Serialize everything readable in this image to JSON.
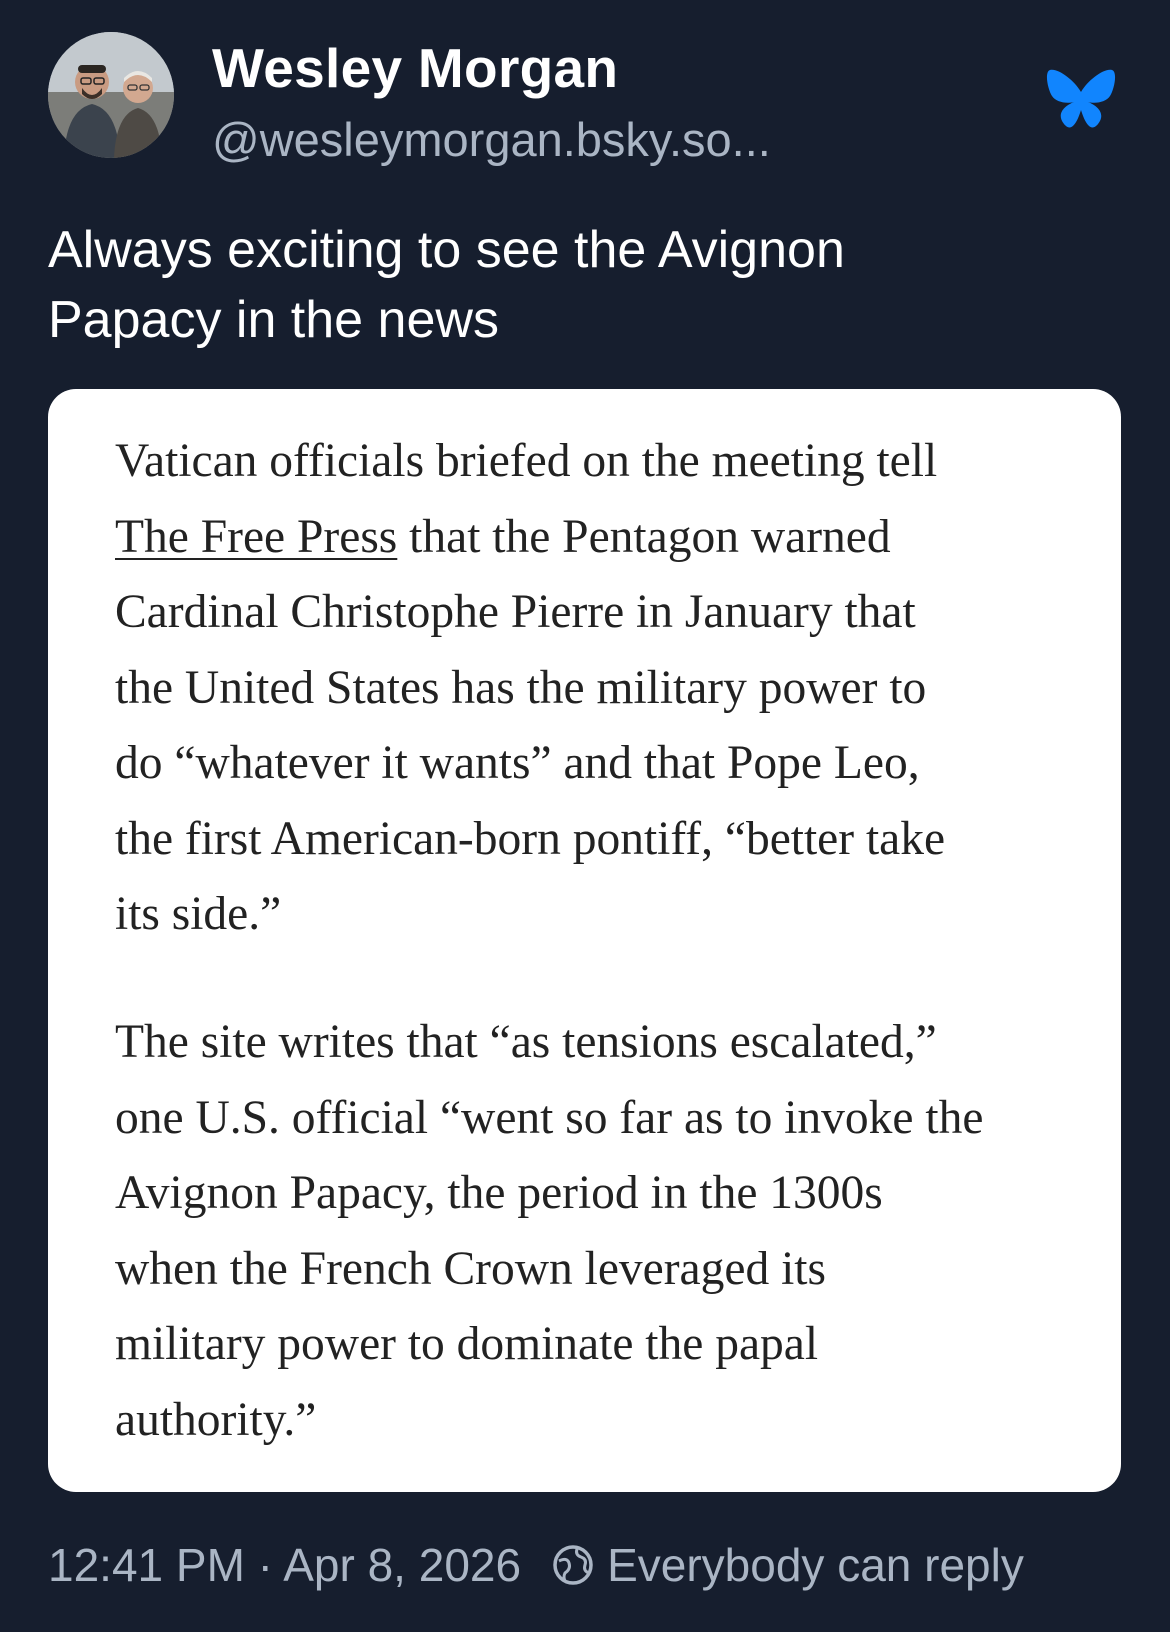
{
  "author": {
    "display_name": "Wesley Morgan",
    "handle": "@wesleymorgan.bsky.so..."
  },
  "app_icon": "bluesky-butterfly-icon",
  "post": {
    "text_line1": "Always exciting to see the Avignon",
    "text_line2": "Papacy in the news"
  },
  "quote": {
    "p1_line1": "Vatican officials briefed on the meeting tell",
    "p1_link": "The Free Press",
    "p1_line2_rest": " that the Pentagon warned",
    "p1_line3": "Cardinal Christophe Pierre in January that",
    "p1_line4": "the United States has the military power to",
    "p1_line5": "do “whatever it wants” and that Pope Leo,",
    "p1_line6": "the first American-born pontiff, “better take",
    "p1_line7": "its side.”",
    "p2_line1": "The site writes that “as tensions escalated,”",
    "p2_line2": "one U.S. official “went so far as to invoke the",
    "p2_line3": "Avignon Papacy, the period in the 1300s",
    "p2_line4": "when the French Crown leveraged its",
    "p2_line5": "military power to dominate the papal",
    "p2_line6": "authority.”"
  },
  "footer": {
    "timestamp": "12:41 PM · Apr 8, 2026",
    "reply_setting": "Everybody can reply"
  },
  "colors": {
    "background": "#161e2e",
    "secondary_text": "#aab5c4",
    "bluesky_blue": "#1185fe",
    "card_background": "#ffffff"
  }
}
